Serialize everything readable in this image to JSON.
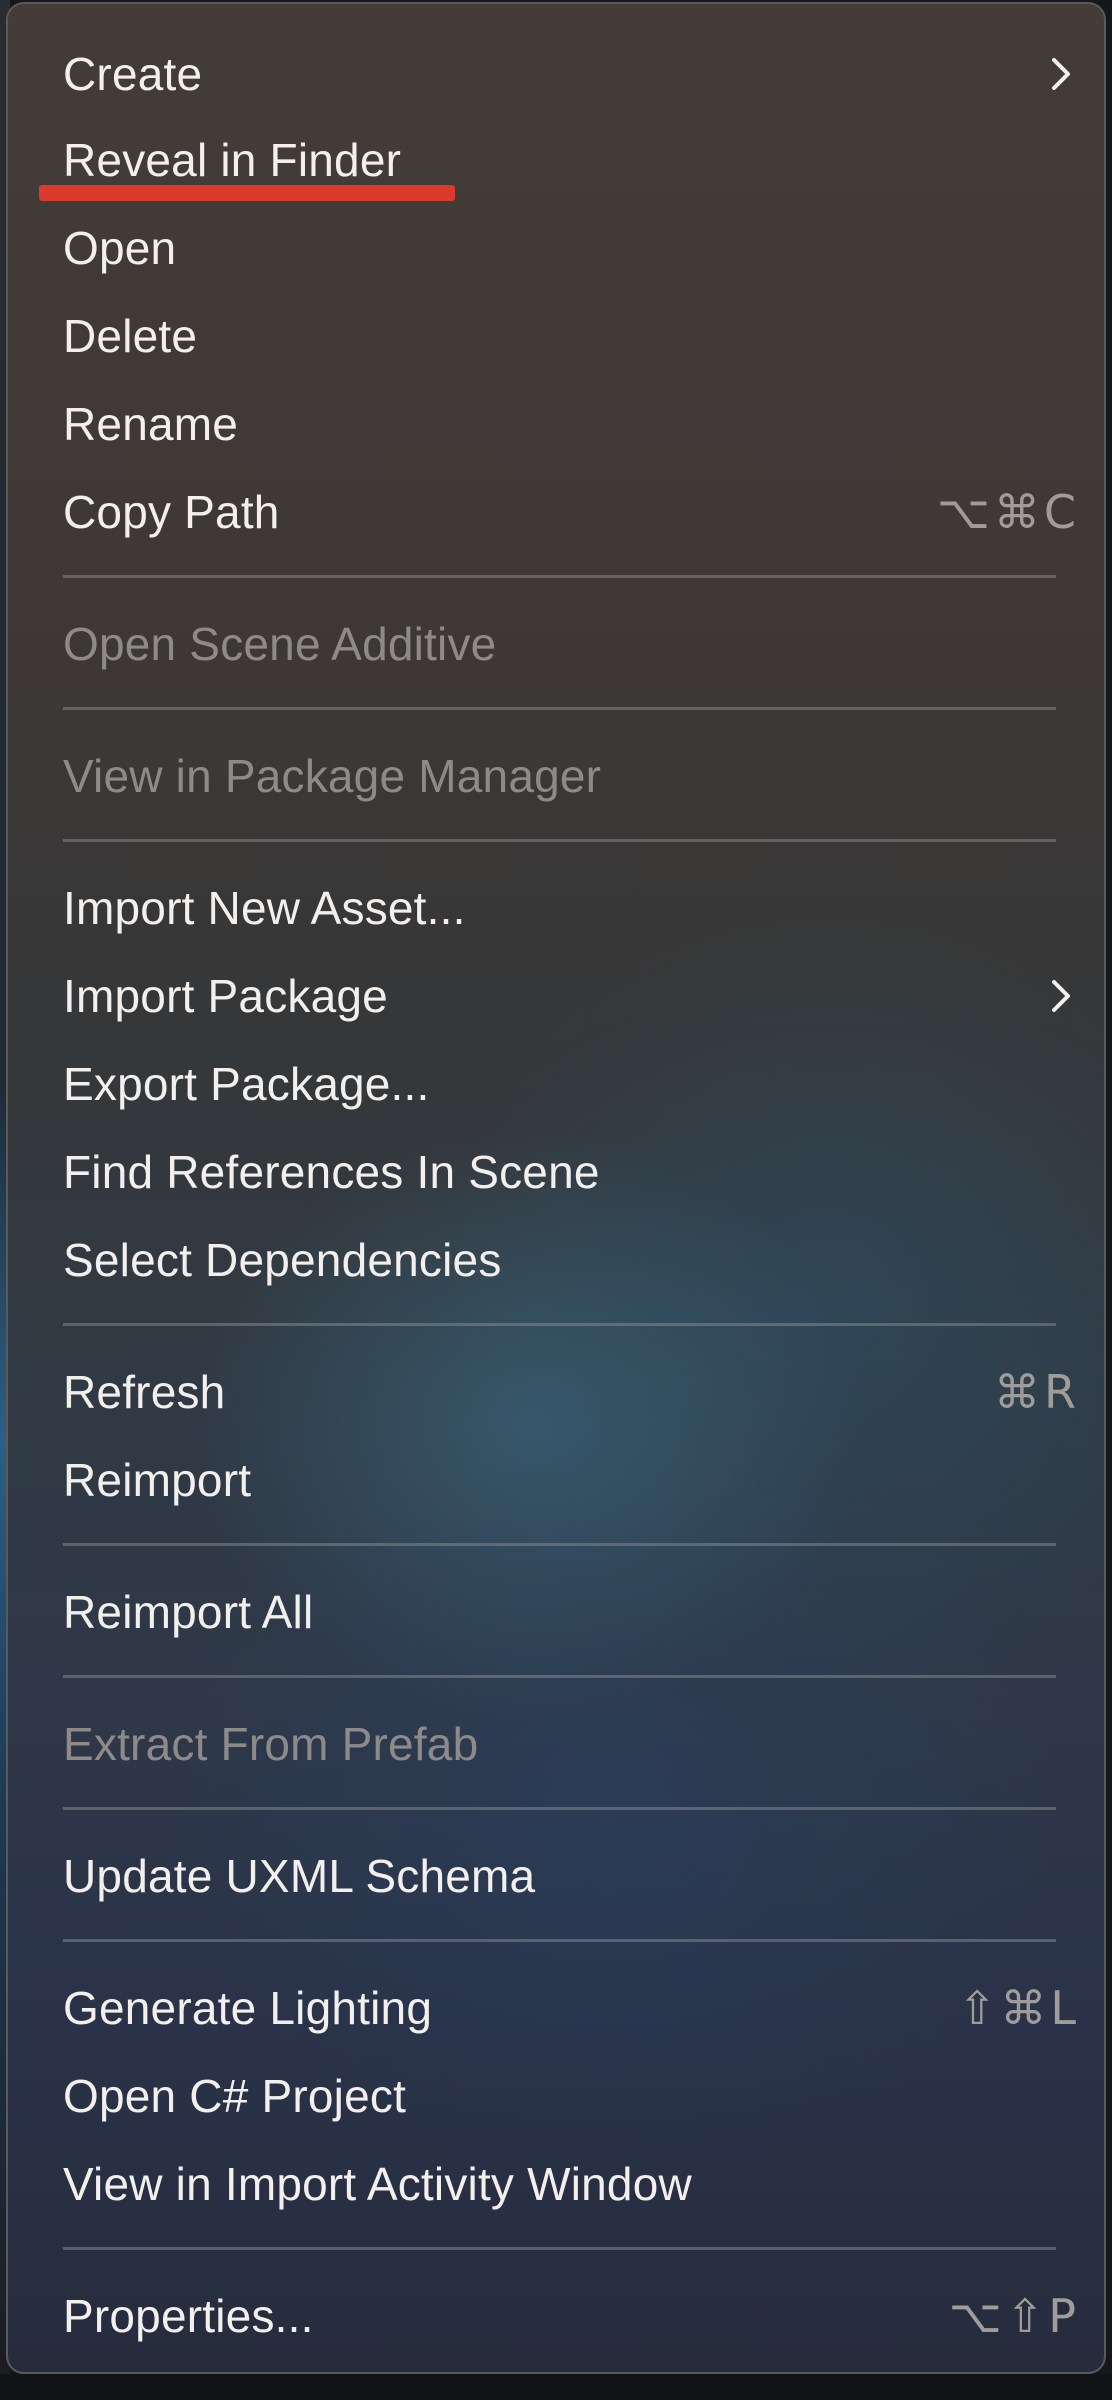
{
  "menu": {
    "items": [
      {
        "label": "Create",
        "submenu": true
      },
      {
        "label": "Reveal in Finder",
        "annotated": true
      },
      {
        "label": "Open"
      },
      {
        "label": "Delete"
      },
      {
        "label": "Rename"
      },
      {
        "label": "Copy Path",
        "shortcut": "⌥⌘C"
      },
      {
        "label": "Open Scene Additive",
        "disabled": true
      },
      {
        "label": "View in Package Manager",
        "disabled": true
      },
      {
        "label": "Import New Asset..."
      },
      {
        "label": "Import Package",
        "submenu": true
      },
      {
        "label": "Export Package..."
      },
      {
        "label": "Find References In Scene"
      },
      {
        "label": "Select Dependencies"
      },
      {
        "label": "Refresh",
        "shortcut": "⌘R"
      },
      {
        "label": "Reimport"
      },
      {
        "label": "Reimport All"
      },
      {
        "label": "Extract From Prefab",
        "disabled": true
      },
      {
        "label": "Update UXML Schema"
      },
      {
        "label": "Generate Lighting",
        "shortcut": "⇧⌘L"
      },
      {
        "label": "Open C# Project"
      },
      {
        "label": "View in Import Activity Window"
      },
      {
        "label": "Properties...",
        "shortcut": "⌥⇧P"
      }
    ]
  },
  "colors": {
    "text": "#f2efec",
    "disabled_text": "#8d8a88",
    "shortcut_text": "#a09c99",
    "annotation": "#d93a2b"
  },
  "icons": {
    "submenu": "chevron-right-icon"
  }
}
